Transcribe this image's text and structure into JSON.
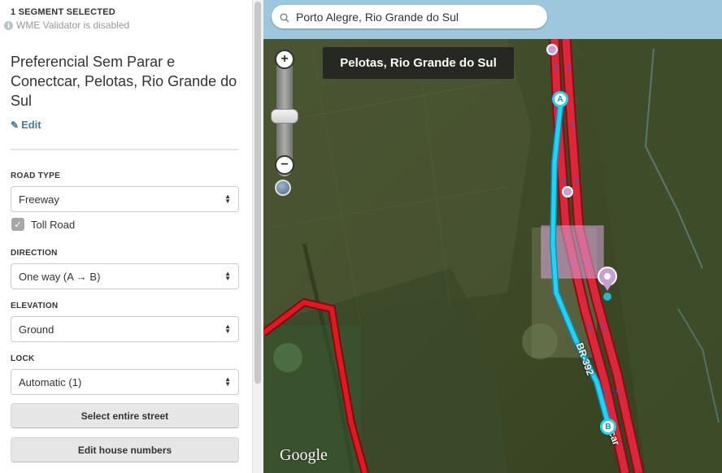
{
  "sidebar": {
    "selection_title": "1 SEGMENT SELECTED",
    "validator_text": "WME Validator is disabled",
    "segment_name": "Preferencial Sem Parar e Conectcar, Pelotas, Rio Grande do Sul",
    "edit_label": "Edit",
    "road_type": {
      "label": "ROAD TYPE",
      "value": "Freeway"
    },
    "toll_road": {
      "label": "Toll Road",
      "checked": true
    },
    "direction": {
      "label": "DIRECTION",
      "value": "One way (A → B)"
    },
    "elevation": {
      "label": "ELEVATION",
      "value": "Ground"
    },
    "lock": {
      "label": "LOCK",
      "value": "Automatic (1)"
    },
    "buttons": {
      "select_street": "Select entire street",
      "house_numbers": "Edit house numbers"
    }
  },
  "map": {
    "search_value": "Porto Alegre, Rio Grande do Sul",
    "city_label": "Pelotas, Rio Grande do Sul",
    "road_label": "BR-392",
    "segment_label_partial": "car",
    "node_a": "A",
    "node_b": "B",
    "attribution": "Google",
    "colors": {
      "freeway": "#d8283a",
      "selected_segment": "#23d3f0",
      "place_area": "#d9a6de",
      "map_bar": "#9cc7dc"
    }
  }
}
